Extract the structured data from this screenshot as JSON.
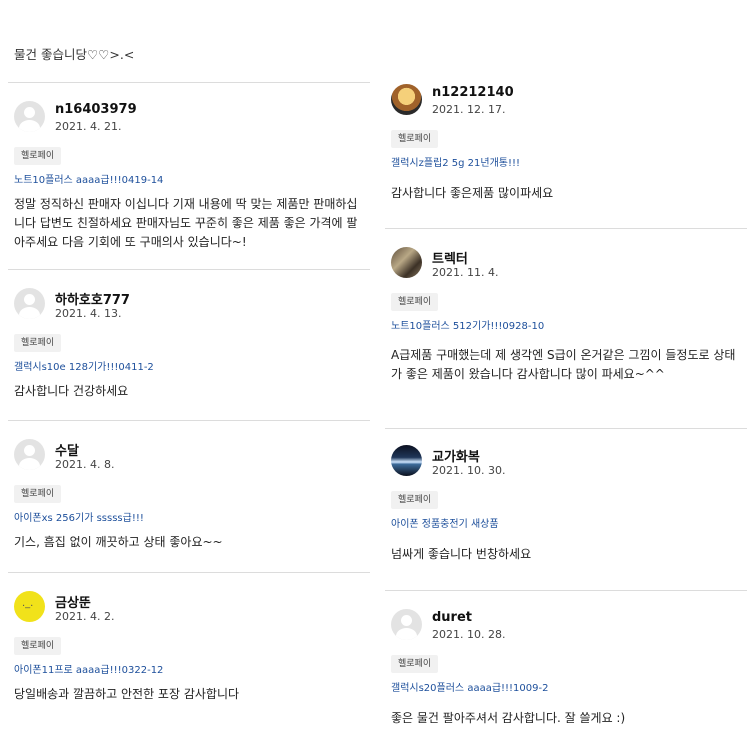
{
  "top_comment": "물건 좋습니당♡♡>.<",
  "left_reviews": [
    {
      "user": "n16403979",
      "date": "2021. 4. 21.",
      "badge": "헬로페이",
      "product": "노트10플러스 aaaa급!!!0419-14",
      "text": "정말 정직하신 판매자 이십니다 기재 내용에 딱 맞는 제품만 판매하십니다 답변도 친절하세요 판매자님도 꾸준히 좋은 제품 좋은 가격에 팔아주세요 다음 기회에 또 구매의사 있습니다~!",
      "avatar": "default"
    },
    {
      "user": "하하호호777",
      "date": "2021. 4. 13.",
      "badge": "헬로페이",
      "product": "갤럭시s10e 128기가!!!0411-2",
      "text": "감사합니다 건강하세요",
      "avatar": "default"
    },
    {
      "user": "수달",
      "date": "2021. 4. 8.",
      "badge": "헬로페이",
      "product": "아이폰xs 256기가 sssss급!!!",
      "text": "기스, 흠집 없이 깨끗하고 상태 좋아요~~",
      "avatar": "default"
    },
    {
      "user": "금상뚠",
      "date": "2021. 4. 2.",
      "badge": "헬로페이",
      "product": "아이폰11프로 aaaa급!!!0322-12",
      "text": "당일배송과 깔끔하고 안전한 포장 감사합니다",
      "avatar": "yellow"
    }
  ],
  "right_reviews": [
    {
      "user": "n12212140",
      "date": "2021. 12. 17.",
      "badge": "헬로페이",
      "product": "갤럭시z플립2 5g 21년개통!!!",
      "text": "감사합니다 좋은제품 많이파세요",
      "avatar": "photo-kid"
    },
    {
      "user": "트렉터",
      "date": "2021. 11. 4.",
      "badge": "헬로페이",
      "product": "노트10플러스 512기가!!!0928-10",
      "text": "A급제품 구매했는데 제 생각엔 S급이 온거같은 그낌이 들정도로 상태가 좋은 제품이 왔습니다 감사합니다 많이 파세요~^^",
      "avatar": "photo-truck"
    },
    {
      "user": "교가화복",
      "date": "2021. 10. 30.",
      "badge": "헬로페이",
      "product": "아이폰 정품충전기 새상품",
      "text": "넘싸게 좋습니다 번창하세요",
      "avatar": "photo-planet"
    },
    {
      "user": "duret",
      "date": "2021. 10. 28.",
      "badge": "헬로페이",
      "product": "갤럭시s20플러스 aaaa급!!!1009-2",
      "text": "좋은 물건 팔아주셔서 감사합니다. 잘 쓸게요 :)",
      "avatar": "default"
    }
  ]
}
